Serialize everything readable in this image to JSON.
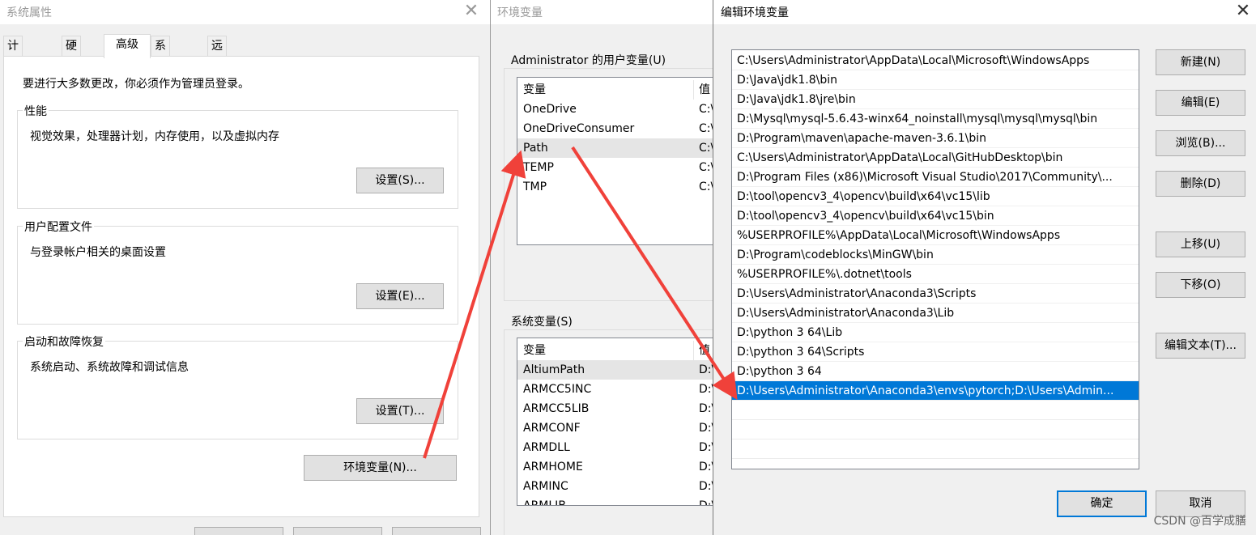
{
  "system_properties": {
    "title": "系统属性",
    "tabs": [
      "计算机名",
      "硬件",
      "高级",
      "系统保护",
      "远程"
    ],
    "note": "要进行大多数更改，你必须作为管理员登录。",
    "performance": {
      "title": "性能",
      "desc": "视觉效果，处理器计划，内存使用，以及虚拟内存",
      "button": "设置(S)..."
    },
    "user_profile": {
      "title": "用户配置文件",
      "desc": "与登录帐户相关的桌面设置",
      "button": "设置(E)..."
    },
    "startup": {
      "title": "启动和故障恢复",
      "desc": "系统启动、系统故障和调试信息",
      "button": "设置(T)..."
    },
    "env_button": "环境变量(N)..."
  },
  "env_vars": {
    "title": "环境变量",
    "user_section": "Administrator 的用户变量(U)",
    "system_section": "系统变量(S)",
    "col_name": "变量",
    "col_value": "值",
    "user_vars": [
      {
        "name": "OneDrive",
        "value": "C:\\"
      },
      {
        "name": "OneDriveConsumer",
        "value": "C:\\"
      },
      {
        "name": "Path",
        "value": "C:\\"
      },
      {
        "name": "TEMP",
        "value": "C:\\"
      },
      {
        "name": "TMP",
        "value": "C:\\"
      }
    ],
    "system_vars": [
      {
        "name": "AltiumPath",
        "value": "D:\\"
      },
      {
        "name": "ARMCC5INC",
        "value": "D:\\"
      },
      {
        "name": "ARMCC5LIB",
        "value": "D:\\"
      },
      {
        "name": "ARMCONF",
        "value": "D:\\"
      },
      {
        "name": "ARMDLL",
        "value": "D:\\"
      },
      {
        "name": "ARMHOME",
        "value": "D:\\"
      },
      {
        "name": "ARMINC",
        "value": "D:\\"
      },
      {
        "name": "ARMLIB",
        "value": "D:\\"
      }
    ]
  },
  "edit_env": {
    "title": "编辑环境变量",
    "paths": [
      "C:\\Users\\Administrator\\AppData\\Local\\Microsoft\\WindowsApps",
      "D:\\Java\\jdk1.8\\bin",
      "D:\\Java\\jdk1.8\\jre\\bin",
      "D:\\Mysql\\mysql-5.6.43-winx64_noinstall\\mysql\\mysql\\mysql\\bin",
      "D:\\Program\\maven\\apache-maven-3.6.1\\bin",
      "C:\\Users\\Administrator\\AppData\\Local\\GitHubDesktop\\bin",
      "D:\\Program Files (x86)\\Microsoft Visual Studio\\2017\\Community\\...",
      "D:\\tool\\opencv3_4\\opencv\\build\\x64\\vc15\\lib",
      "D:\\tool\\opencv3_4\\opencv\\build\\x64\\vc15\\bin",
      "%USERPROFILE%\\AppData\\Local\\Microsoft\\WindowsApps",
      "D:\\Program\\codeblocks\\MinGW\\bin",
      "%USERPROFILE%\\.dotnet\\tools",
      "D:\\Users\\Administrator\\Anaconda3\\Scripts",
      "D:\\Users\\Administrator\\Anaconda3\\Lib",
      "D:\\python 3 64\\Lib",
      "D:\\python 3 64\\Scripts",
      "D:\\python 3 64",
      "D:\\Users\\Administrator\\Anaconda3\\envs\\pytorch;D:\\Users\\Admin..."
    ],
    "selected_index": 17,
    "buttons": {
      "new": "新建(N)",
      "edit": "编辑(E)",
      "browse": "浏览(B)...",
      "delete": "删除(D)",
      "up": "上移(U)",
      "down": "下移(O)",
      "edit_text": "编辑文本(T)...",
      "ok": "确定",
      "cancel": "取消"
    }
  },
  "watermark": "CSDN @百学成膳",
  "colors": {
    "selection": "#0078d7",
    "arrow": "#f0413a"
  }
}
